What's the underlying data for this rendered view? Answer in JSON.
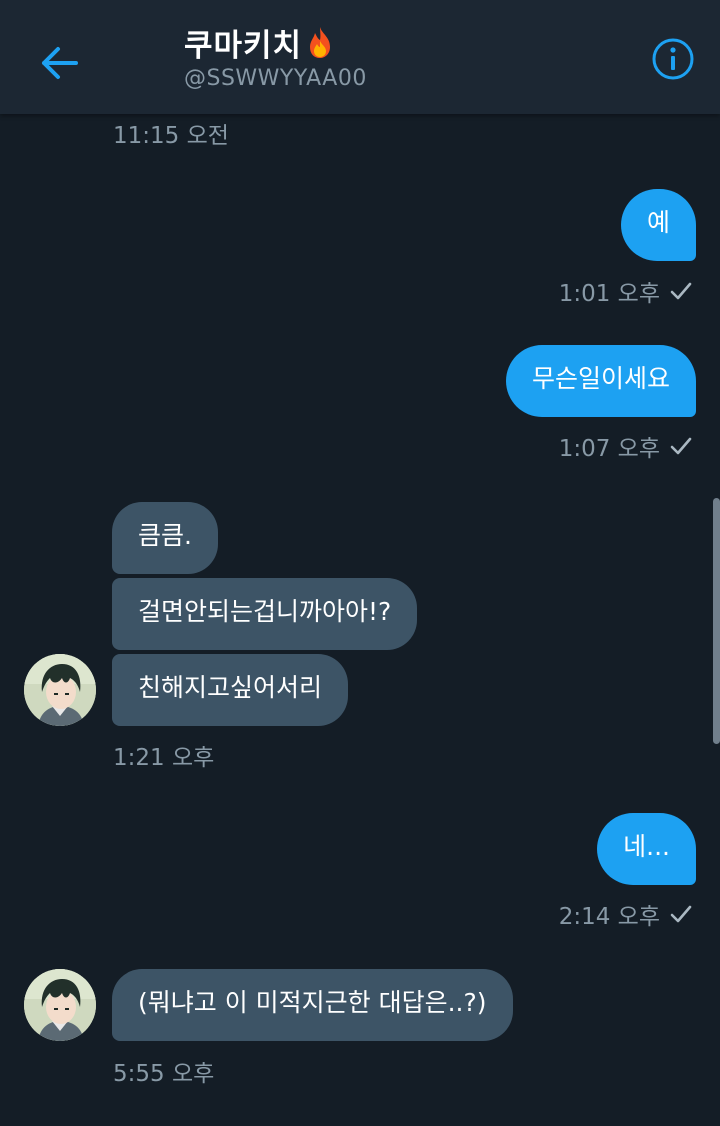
{
  "header": {
    "title": "쿠마키치",
    "handle": "@SSWWYYAA00",
    "back_icon": "arrow-left-icon",
    "info_icon": "info-icon",
    "title_emoji": "fire-icon",
    "accent_color": "#1da1f2",
    "background_color": "#1c2733"
  },
  "conversation": {
    "top_timestamp": "11:15 오전",
    "messages": [
      {
        "direction": "sent",
        "text": "예",
        "time": "1:01 오후"
      },
      {
        "direction": "sent",
        "text": "무슨일이세요",
        "time": "1:07 오후"
      },
      {
        "direction": "received",
        "text": "큼큼."
      },
      {
        "direction": "received",
        "text": "걸면안되는겁니까아아!?"
      },
      {
        "direction": "received",
        "text": "친해지고싶어서리",
        "time": "1:21 오후"
      },
      {
        "direction": "sent",
        "text": "네...",
        "time": "2:14 오후"
      },
      {
        "direction": "received",
        "text": "(뭐냐고 이 미적지근한 대답은..?)",
        "time": "5:55 오후"
      }
    ],
    "sent_bubble_color": "#1da1f2",
    "received_bubble_color": "#3d5466",
    "background_color": "#141d26"
  }
}
